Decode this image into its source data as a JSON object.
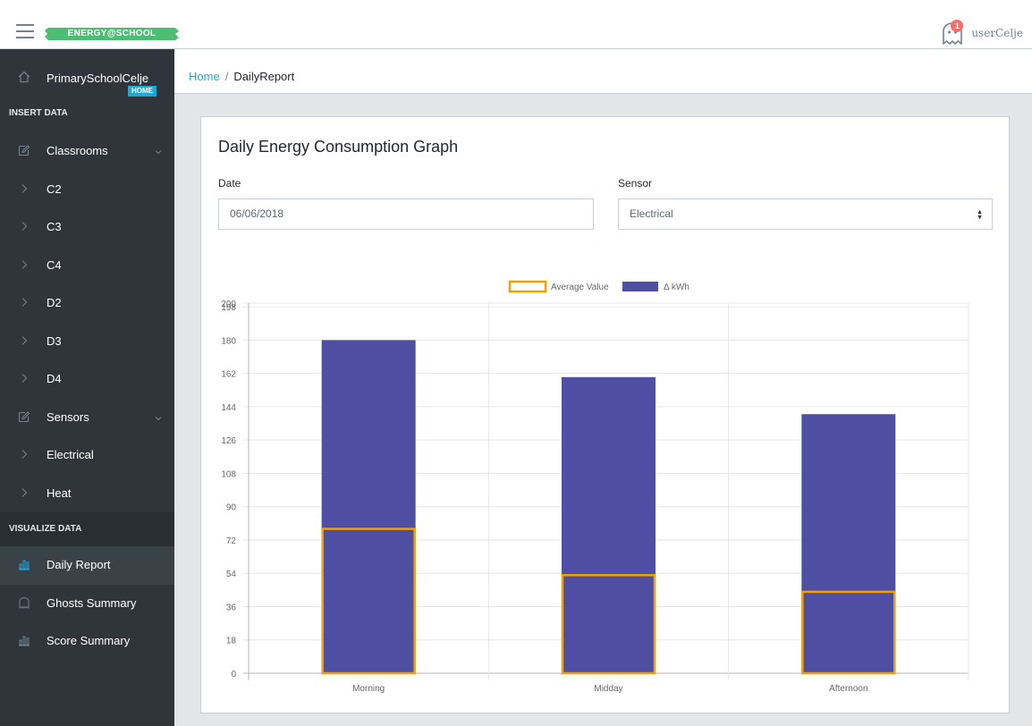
{
  "header": {
    "logo_text": "ENERGY@SCHOOL",
    "notification_count": "1",
    "username": "userCelje"
  },
  "sidebar": {
    "school": "PrimarySchoolCelje",
    "home_badge": "HOME",
    "section_insert": "INSERT DATA",
    "classrooms_label": "Classrooms",
    "classrooms": [
      {
        "label": "C2"
      },
      {
        "label": "C3"
      },
      {
        "label": "C4"
      },
      {
        "label": "D2"
      },
      {
        "label": "D3"
      },
      {
        "label": "D4"
      }
    ],
    "sensors_label": "Sensors",
    "sensors": [
      {
        "label": "Electrical"
      },
      {
        "label": "Heat"
      }
    ],
    "section_visualize": "VISUALIZE DATA",
    "visualize": [
      {
        "label": "Daily Report",
        "icon": "bar-chart-icon",
        "active": true
      },
      {
        "label": "Ghosts Summary",
        "icon": "ghost-icon",
        "active": false
      },
      {
        "label": "Score Summary",
        "icon": "bar-chart-icon",
        "active": false
      }
    ]
  },
  "breadcrumb": {
    "home": "Home",
    "separator": "/",
    "current": "DailyReport"
  },
  "card": {
    "title": "Daily Energy Consumption Graph",
    "date_label": "Date",
    "date_value": "06/06/2018",
    "sensor_label": "Sensor",
    "sensor_value": "Electrical"
  },
  "colors": {
    "bar_fill": "#4e4fa2",
    "average_stroke": "#f59f00",
    "sidebar_bg": "#2f353a",
    "accent": "#20a8d8",
    "logo_green": "#4dbd74"
  },
  "chart_data": {
    "type": "bar",
    "categories": [
      "Morning",
      "Midday",
      "Afternoon"
    ],
    "series": [
      {
        "name": "Average Value",
        "values": [
          78,
          53,
          44
        ],
        "style": "outline"
      },
      {
        "name": "Δ kWh",
        "values": [
          180,
          160,
          140
        ],
        "style": "filled"
      }
    ],
    "yticks": [
      0,
      18,
      36,
      54,
      72,
      90,
      108,
      126,
      144,
      162,
      180,
      198,
      200
    ],
    "ylim": [
      0,
      200
    ],
    "grid": true,
    "legend": "top-center"
  }
}
